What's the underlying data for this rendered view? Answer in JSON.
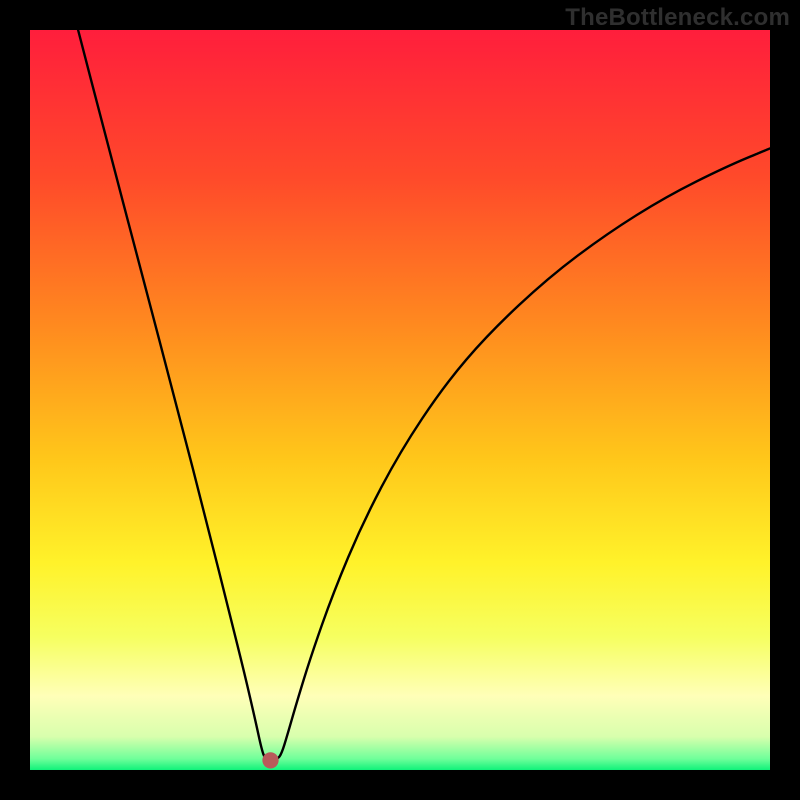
{
  "watermark": "TheBottleneck.com",
  "chart_data": {
    "type": "line",
    "title": "",
    "xlabel": "",
    "ylabel": "",
    "xlim": [
      0,
      100
    ],
    "ylim": [
      0,
      100
    ],
    "grid": false,
    "legend": false,
    "background_gradient_stops": [
      {
        "pos": 0.0,
        "color": "#ff1e3c"
      },
      {
        "pos": 0.2,
        "color": "#ff4a2a"
      },
      {
        "pos": 0.4,
        "color": "#ff8a1f"
      },
      {
        "pos": 0.58,
        "color": "#ffc71a"
      },
      {
        "pos": 0.72,
        "color": "#fff22a"
      },
      {
        "pos": 0.82,
        "color": "#f6ff60"
      },
      {
        "pos": 0.9,
        "color": "#ffffb8"
      },
      {
        "pos": 0.955,
        "color": "#d8ffad"
      },
      {
        "pos": 0.985,
        "color": "#6fff9a"
      },
      {
        "pos": 1.0,
        "color": "#10f27a"
      }
    ],
    "marker": {
      "x": 32.5,
      "y": 1.3,
      "color": "#b85a5a",
      "radius": 1.1
    },
    "series": [
      {
        "name": "curve",
        "color": "#000000",
        "points": [
          {
            "x": 6.5,
            "y": 100.0
          },
          {
            "x": 10.0,
            "y": 86.5
          },
          {
            "x": 15.0,
            "y": 67.5
          },
          {
            "x": 20.0,
            "y": 48.5
          },
          {
            "x": 24.0,
            "y": 33.0
          },
          {
            "x": 27.0,
            "y": 21.0
          },
          {
            "x": 29.0,
            "y": 13.0
          },
          {
            "x": 30.5,
            "y": 6.5
          },
          {
            "x": 31.3,
            "y": 2.8
          },
          {
            "x": 31.8,
            "y": 1.4
          },
          {
            "x": 33.4,
            "y": 1.4
          },
          {
            "x": 34.0,
            "y": 2.2
          },
          {
            "x": 34.8,
            "y": 4.8
          },
          {
            "x": 36.0,
            "y": 9.0
          },
          {
            "x": 38.0,
            "y": 15.5
          },
          {
            "x": 41.0,
            "y": 24.0
          },
          {
            "x": 45.0,
            "y": 33.5
          },
          {
            "x": 50.0,
            "y": 43.0
          },
          {
            "x": 56.0,
            "y": 52.0
          },
          {
            "x": 62.0,
            "y": 59.0
          },
          {
            "x": 70.0,
            "y": 66.5
          },
          {
            "x": 78.0,
            "y": 72.5
          },
          {
            "x": 86.0,
            "y": 77.5
          },
          {
            "x": 94.0,
            "y": 81.5
          },
          {
            "x": 100.0,
            "y": 84.0
          }
        ]
      }
    ]
  }
}
